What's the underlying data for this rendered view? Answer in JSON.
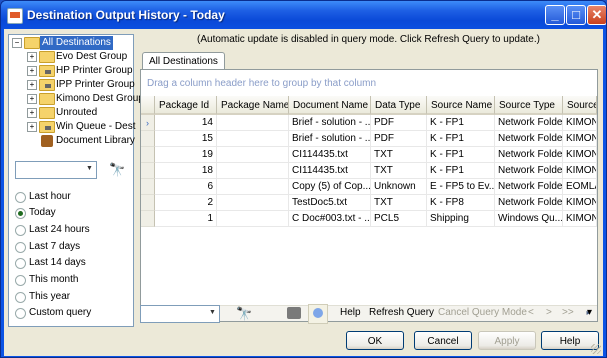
{
  "window": {
    "title": "Destination Output History - Today"
  },
  "tree": {
    "items": [
      {
        "label": "All Destinations",
        "selected": true,
        "icon": "folder-icon"
      },
      {
        "label": "Evo Dest Group",
        "icon": "folder-icon"
      },
      {
        "label": "HP Printer Group",
        "icon": "folder-icon"
      },
      {
        "label": "IPP Printer Group",
        "icon": "folder-icon"
      },
      {
        "label": "Kimono Dest Group",
        "icon": "folder-icon"
      },
      {
        "label": "Unrouted",
        "icon": "folder-icon"
      },
      {
        "label": "Win Queue - Dest",
        "icon": "folder-icon"
      },
      {
        "label": "Document Library",
        "icon": "library-icon"
      }
    ]
  },
  "periods": {
    "options": [
      "Last hour",
      "Today",
      "Last 24 hours",
      "Last 7 days",
      "Last 14 days",
      "This month",
      "This year",
      "Custom query"
    ],
    "selected": "Today"
  },
  "notice": "(Automatic update is disabled in query mode.  Click Refresh Query to update.)",
  "tabs": [
    "All Destinations"
  ],
  "grid": {
    "group_hint": "Drag a column header here to group by that column",
    "columns": [
      "Package Id",
      "Package Name",
      "Document Name",
      "Data Type",
      "Source Name",
      "Source Type",
      "Source S"
    ],
    "rows": [
      [
        "14",
        "",
        "Brief - solution  - ...",
        "PDF",
        "K - FP1",
        "Network Folder",
        "KIMONO"
      ],
      [
        "15",
        "",
        "Brief - solution  - ...",
        "PDF",
        "K - FP1",
        "Network Folder",
        "KIMONO"
      ],
      [
        "19",
        "",
        "CI114435.txt",
        "TXT",
        "K - FP1",
        "Network Folder",
        "KIMONO"
      ],
      [
        "18",
        "",
        "CI114435.txt",
        "TXT",
        "K - FP1",
        "Network Folder",
        "KIMONO"
      ],
      [
        "6",
        "",
        "Copy (5) of Cop...",
        "Unknown",
        "E - FP5 to Ev...",
        "Network Folder",
        "EOMLAB"
      ],
      [
        "2",
        "",
        "TestDoc5.txt",
        "TXT",
        "K - FP8",
        "Network Folder",
        "KIMONO"
      ],
      [
        "1",
        "",
        "C Doc#003.txt - ...",
        "PCL5",
        "Shipping",
        "Windows Qu...",
        "KIMONO"
      ]
    ]
  },
  "toolbar": {
    "help": "Help",
    "refresh_query": "Refresh Query",
    "cancel_query": "Cancel Query Mode",
    "nav_prev": "<",
    "nav_next": ">",
    "nav_last": ">>",
    "nav_more": "▾"
  },
  "buttons": {
    "ok": "OK",
    "cancel": "Cancel",
    "apply": "Apply",
    "help": "Help"
  },
  "titlebar_buttons": {
    "minimize": "_",
    "maximize": "□",
    "close": "✕"
  }
}
